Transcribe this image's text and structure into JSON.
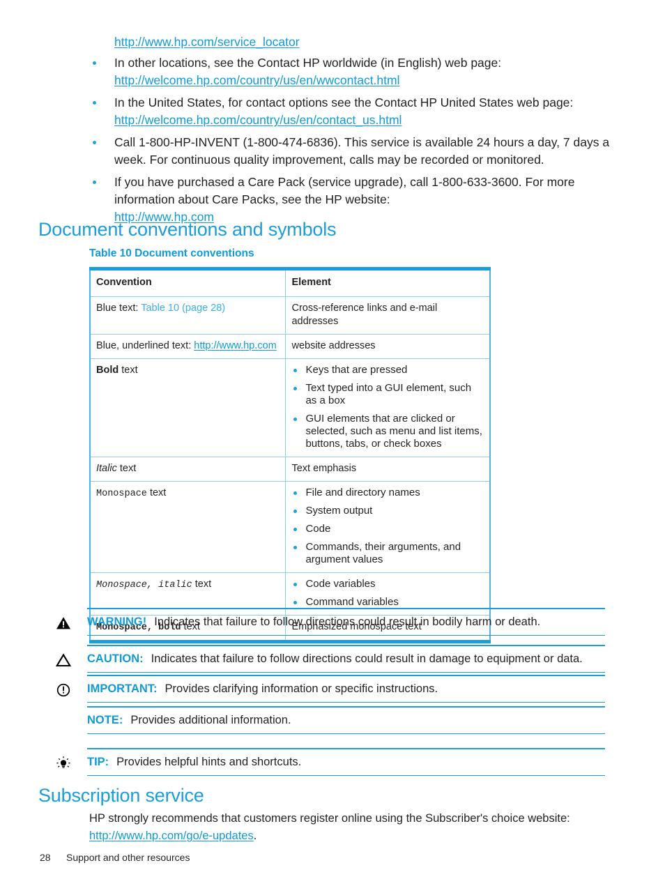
{
  "colors": {
    "hp_blue": "#0f9bd7",
    "heading_blue": "#1b9dd9",
    "xref_blue": "#3bb0e3",
    "table_border_light": "#8ccdeb",
    "text": "#231f20"
  },
  "top_list": {
    "lead_link": "http://www.hp.com/service_locator",
    "items": [
      {
        "text": "In other locations, see the Contact HP worldwide (in English) web page:",
        "link": "http://welcome.hp.com/country/us/en/wwcontact.html"
      },
      {
        "text": "In the United States, for contact options see the Contact HP United States web page:",
        "link": "http://welcome.hp.com/country/us/en/contact_us.html"
      },
      {
        "text": "Call 1-800-HP-INVENT (1-800-474-6836). This service is available 24 hours a day, 7 days a week. For continuous quality improvement, calls may be recorded or monitored.",
        "link": ""
      },
      {
        "text": "If you have purchased a Care Pack (service upgrade), call 1-800-633-3600. For more information about Care Packs, see the HP website:",
        "link": "http://www.hp.com"
      }
    ]
  },
  "sections": {
    "document_conventions": "Document conventions and symbols",
    "subscription_service": "Subscription service"
  },
  "table": {
    "caption": "Table 10 Document conventions",
    "headers": [
      "Convention",
      "Element"
    ],
    "rows": [
      {
        "convention_prefix": "Blue text: ",
        "convention_xref": "Table 10 (page 28)",
        "element": "Cross-reference links and e-mail addresses"
      },
      {
        "convention_prefix": "Blue, underlined text: ",
        "convention_link": "http://www.hp.com",
        "element": "website addresses"
      },
      {
        "convention_bold": "Bold",
        "convention_suffix": " text",
        "element_bullets": [
          "Keys that are pressed",
          "Text typed into a GUI element, such as a box",
          "GUI elements that are clicked or selected, such as menu and list items, buttons, tabs, or check boxes"
        ]
      },
      {
        "convention_italic": "Italic",
        "convention_suffix": " text",
        "element": "Text emphasis"
      },
      {
        "convention_mono": "Monospace",
        "convention_suffix": " text",
        "element_bullets": [
          "File and directory names",
          "System output",
          "Code",
          "Commands, their arguments, and argument values"
        ]
      },
      {
        "convention_mono_italic": "Monospace, italic",
        "convention_suffix": " text",
        "element_bullets": [
          "Code variables",
          "Command variables"
        ]
      },
      {
        "convention_mono_bold": "Monospace, bold",
        "convention_suffix": " text",
        "element": "Emphasized monospace text"
      }
    ]
  },
  "admonitions": [
    {
      "icon": "warning-triangle-filled-icon",
      "keyword": "WARNING!",
      "text": "Indicates that failure to follow directions could result in bodily harm or death."
    },
    {
      "icon": "caution-triangle-outline-icon",
      "keyword": "CAUTION:",
      "text": "Indicates that failure to follow directions could result in damage to equipment or data."
    },
    {
      "icon": "important-circle-exclamation-icon",
      "keyword": "IMPORTANT:",
      "text": "Provides clarifying information or specific instructions."
    },
    {
      "icon": "",
      "keyword": "NOTE:",
      "text": "Provides additional information."
    },
    {
      "icon": "tip-lightbulb-icon",
      "keyword": "TIP:",
      "text": "Provides helpful hints and shortcuts."
    }
  ],
  "subscription": {
    "text": "HP strongly recommends that customers register online using the Subscriber's choice website:",
    "link": "http://www.hp.com/go/e-updates",
    "period": "."
  },
  "footer": {
    "page_number": "28",
    "chapter": "Support and other resources"
  }
}
